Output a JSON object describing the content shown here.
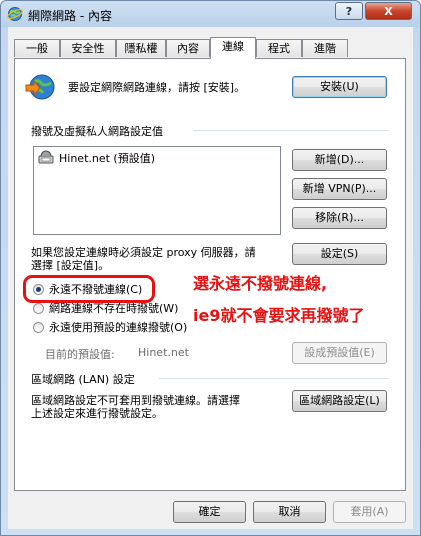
{
  "window": {
    "title": "網際網路 - 內容",
    "help_label": "?",
    "close_label": "X"
  },
  "tabs": [
    {
      "label": "一般"
    },
    {
      "label": "安全性"
    },
    {
      "label": "隱私權"
    },
    {
      "label": "內容"
    },
    {
      "label": "連線"
    },
    {
      "label": "程式"
    },
    {
      "label": "進階"
    }
  ],
  "active_tab": "連線",
  "setup": {
    "text": "要設定網際網路連線，請按 [安裝]。",
    "button": "安裝(U)"
  },
  "dialup": {
    "section_title": "撥號及虛擬私人網路設定值",
    "items": [
      {
        "label": "Hinet.net (預設值)"
      }
    ],
    "add_button": "新增(D)...",
    "add_vpn_button": "新增 VPN(P)...",
    "remove_button": "移除(R)...",
    "settings_note": [
      "如果您設定連線時必須設定 proxy 伺服器，請",
      "選擇 [設定值]。"
    ],
    "settings_button": "設定(S)",
    "options": [
      {
        "label": "永遠不撥號連線(C)",
        "checked": true
      },
      {
        "label": "網路連線不存在時撥號(W)",
        "checked": false
      },
      {
        "label": "永遠使用預設的連線撥號(O)",
        "checked": false
      }
    ],
    "current_default_label": "目前的預設值:",
    "current_default_value": "Hinet.net",
    "set_default_button": "設成預設值(E)"
  },
  "lan": {
    "section_title": "區域網路 (LAN) 設定",
    "note": [
      "區域網路設定不可套用到撥號連線。請選擇",
      "上述設定來進行撥號設定。"
    ],
    "button": "區域網路設定(L)"
  },
  "annotation": {
    "lines": [
      "選永遠不撥號連線,",
      "ie9就不會要求再撥號了"
    ],
    "color": "#e81010"
  },
  "footer": {
    "ok": "確定",
    "cancel": "取消",
    "apply": "套用(A)"
  }
}
